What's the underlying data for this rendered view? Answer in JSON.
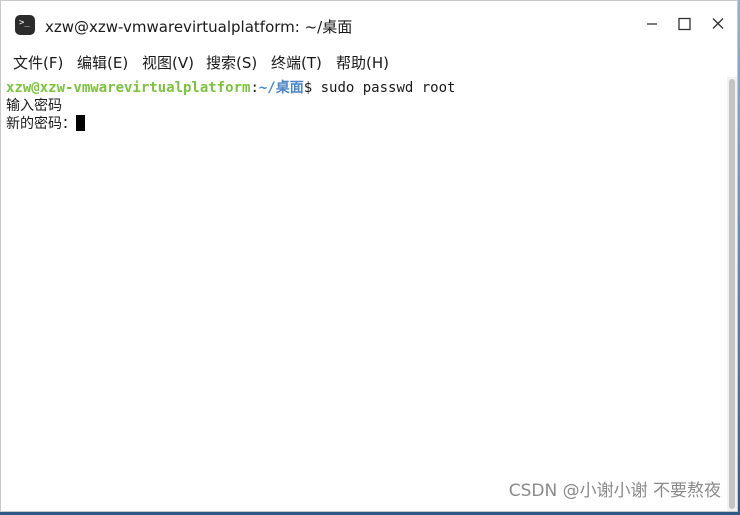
{
  "window": {
    "title": "xzw@xzw-vmwarevirtualplatform: ~/桌面",
    "app_icon": "terminal-icon",
    "app_icon_glyph": ">_",
    "controls": [
      "minimize-icon",
      "maximize-icon",
      "close-icon"
    ]
  },
  "menubar": {
    "items": [
      "文件(F)",
      "编辑(E)",
      "视图(V)",
      "搜索(S)",
      "终端(T)",
      "帮助(H)"
    ]
  },
  "terminal": {
    "prompt_user": "xzw@xzw-vmwarevirtualplatform",
    "prompt_colon": ":",
    "prompt_path": "~/桌面",
    "prompt_symbol": "$ ",
    "command": "sudo passwd root",
    "line2": "输入密码",
    "line3": "新的密码："
  },
  "colors": {
    "prompt_user": "#7cc43e",
    "prompt_path": "#4a86c8",
    "background": "#ffffff",
    "text": "#1a1a1a"
  },
  "watermark": "CSDN @小谢小谢 不要熬夜"
}
